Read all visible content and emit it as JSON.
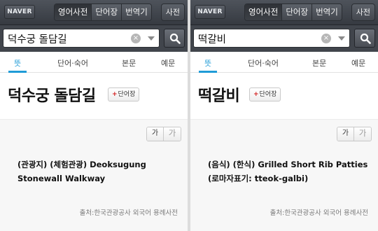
{
  "panels": [
    {
      "logo": "NAVER",
      "nav": [
        "영어사전",
        "단어장",
        "번역기"
      ],
      "dict_label": "사전",
      "search_value": "덕수궁 돌담길",
      "clear_glyph": "×",
      "tabs": [
        "뜻",
        "단어·숙어",
        "본문",
        "예문"
      ],
      "headword": "덕수궁 돌담길",
      "wordbook_plus": "+",
      "wordbook_label": "단어장",
      "font_small": "가",
      "font_large": "가",
      "meaning_line1": "(관광지) (체험관광) Deoksugung",
      "meaning_line2": "Stonewall Walkway",
      "source": "출처:한국관광공사 외국어 용례사전"
    },
    {
      "logo": "NAVER",
      "nav": [
        "영어사전",
        "단어장",
        "번역기"
      ],
      "dict_label": "사전",
      "search_value": "떡갈비",
      "clear_glyph": "×",
      "tabs": [
        "뜻",
        "단어·숙어",
        "본문",
        "예문"
      ],
      "headword": "떡갈비",
      "wordbook_plus": "+",
      "wordbook_label": "단어장",
      "font_small": "가",
      "font_large": "가",
      "meaning_line1": "(음식) (한식) Grilled Short Rib Patties",
      "meaning_line2": "(로마자표기: tteok-galbi)",
      "source": "출처:한국관광공사 외국어 용례사전"
    }
  ],
  "colors": {
    "accent": "#1f9bd7",
    "topbar": "#3f434a",
    "plus_red": "#d21a1a"
  },
  "icons": {
    "search": "search-icon",
    "clear": "clear-icon",
    "dropdown": "dropdown-arrow-icon"
  }
}
